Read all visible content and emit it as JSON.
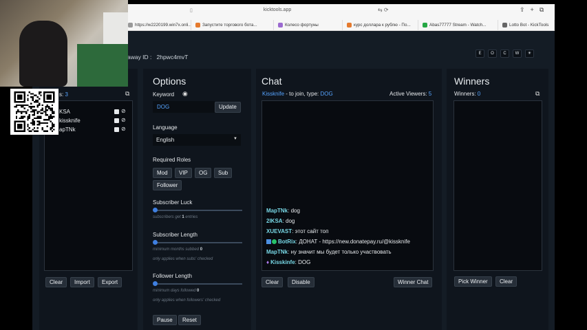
{
  "browser": {
    "url": "kicktools.app",
    "tabs": [
      {
        "label": "https://w2220199.win7x.onli...",
        "color": "#999999",
        "w": 98
      },
      {
        "label": "Запустите торгового бота...",
        "color": "#e57a2e",
        "w": 120
      },
      {
        "label": "Колесо фортуны",
        "color": "#9b6ad0",
        "w": 100
      },
      {
        "label": "курс доллара к рублю - По...",
        "color": "#e57a2e",
        "w": 110
      },
      {
        "label": "Abas77777 Stream - Watch...",
        "color": "#26a845",
        "w": 116
      },
      {
        "label": "Lotto Bot - KickTools",
        "color": "#666666",
        "w": 82
      }
    ]
  },
  "header": {
    "giveaway_label": "veaway ID :",
    "giveaway_id": "2hpwc4mvT",
    "buttons": [
      "E",
      "O",
      "C",
      "W",
      "☀"
    ]
  },
  "entries": {
    "count_prefix": "s:",
    "count": "3",
    "items": [
      "KSA",
      "kissknife",
      "apTNk"
    ],
    "clear": "Clear",
    "import": "Import",
    "export": "Export"
  },
  "options": {
    "title": "Options",
    "keyword_label": "Keyword",
    "keyword_value": "DOG",
    "update": "Update",
    "language_label": "Language",
    "language_value": "English",
    "roles_label": "Required Roles",
    "roles": [
      "Mod",
      "VIP",
      "OG",
      "Sub",
      "Follower"
    ],
    "sub_luck_label": "Subscriber Luck",
    "sub_luck_hint_a": "subscribers get",
    "sub_luck_hint_num": "1",
    "sub_luck_hint_b": "entries",
    "sub_length_label": "Subscriber Length",
    "sub_length_hint_a": "minimum months subbed",
    "sub_length_hint_num": "0",
    "sub_length_note": "only applies when subs' checked",
    "fol_length_label": "Follower Length",
    "fol_length_hint_a": "minimum days followed",
    "fol_length_hint_num": "0",
    "fol_length_note": "only applies when followers' checked",
    "pause": "Pause",
    "reset": "Reset"
  },
  "chat": {
    "title": "Chat",
    "streamer": "Kissknife",
    "join_text": "- to join, type:",
    "keyword": "DOG",
    "viewers_label": "Active Viewers:",
    "viewers": "5",
    "messages": [
      {
        "user": "MapTNk",
        "text": "dog",
        "badges": ""
      },
      {
        "user": "2IKSA",
        "text": "dog",
        "badges": ""
      },
      {
        "user": "XUEVAST",
        "text": "этот сайт топ",
        "badges": ""
      },
      {
        "user": "BotRix",
        "text": "ДОНАТ - https://new.donatepay.ru/@kissknife",
        "badges": "bot"
      },
      {
        "user": "MapTNk",
        "text": "ну значит мы будет только участвовать",
        "badges": ""
      },
      {
        "user": "Kisskinfe",
        "text": "DOG",
        "badges": "host"
      }
    ],
    "clear": "Clear",
    "disable": "Disable",
    "winner_chat": "Winner Chat"
  },
  "winners": {
    "title": "Winners",
    "count_label": "Winners:",
    "count": "0",
    "pick": "Pick Winner",
    "clear": "Clear"
  }
}
